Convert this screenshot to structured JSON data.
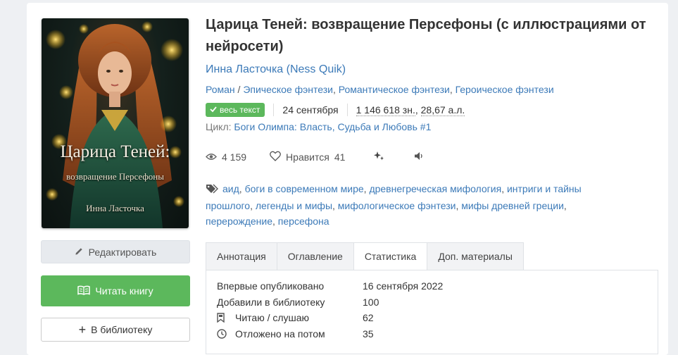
{
  "book": {
    "title": "Царица Теней: возвращение Персефоны (с иллюстрациями от нейросети)",
    "author": "Инна Ласточка (Ness Quik)",
    "genre_primary": "Роман",
    "genre_sep": "/",
    "genres": [
      "Эпическое фэнтези",
      "Романтическое фэнтези",
      "Героическое фэнтези"
    ],
    "badge_label": "весь текст",
    "date": "24 сентября",
    "size_chars": "1 146 618 зн.",
    "size_al": "28,67 а.л.",
    "cycle_label": "Цикл:",
    "cycle_value": "Боги Олимпа: Власть, Судьба и Любовь #1"
  },
  "cover": {
    "title": "Царица Теней:",
    "subtitle": "возвращение Персефоны",
    "author": "Инна Ласточка"
  },
  "stats": {
    "views": "4 159",
    "likes_label": "Нравится",
    "likes_count": "41"
  },
  "tags": [
    "аид",
    "боги в современном мире",
    "древнегреческая мифология",
    "интриги и тайны прошлого",
    "легенды и мифы",
    "мифологическое фэнтези",
    "мифы древней греции",
    "перерождение",
    "персефона"
  ],
  "actions": {
    "edit": "Редактировать",
    "read": "Читать книгу",
    "library": "В библиотеку"
  },
  "tabs": [
    "Аннотация",
    "Оглавление",
    "Статистика",
    "Доп. материалы"
  ],
  "active_tab": "Статистика",
  "statistics": [
    {
      "label": "Впервые опубликовано",
      "value": "16 сентября 2022",
      "icon": ""
    },
    {
      "label": "Добавили в библиотеку",
      "value": "100",
      "icon": ""
    },
    {
      "label": "Читаю / слушаю",
      "value": "62",
      "icon": "bookmark-icon"
    },
    {
      "label": "Отложено на потом",
      "value": "35",
      "icon": "clock-icon"
    }
  ],
  "colors": {
    "link": "#3c7ab8",
    "green": "#5cb85c"
  }
}
